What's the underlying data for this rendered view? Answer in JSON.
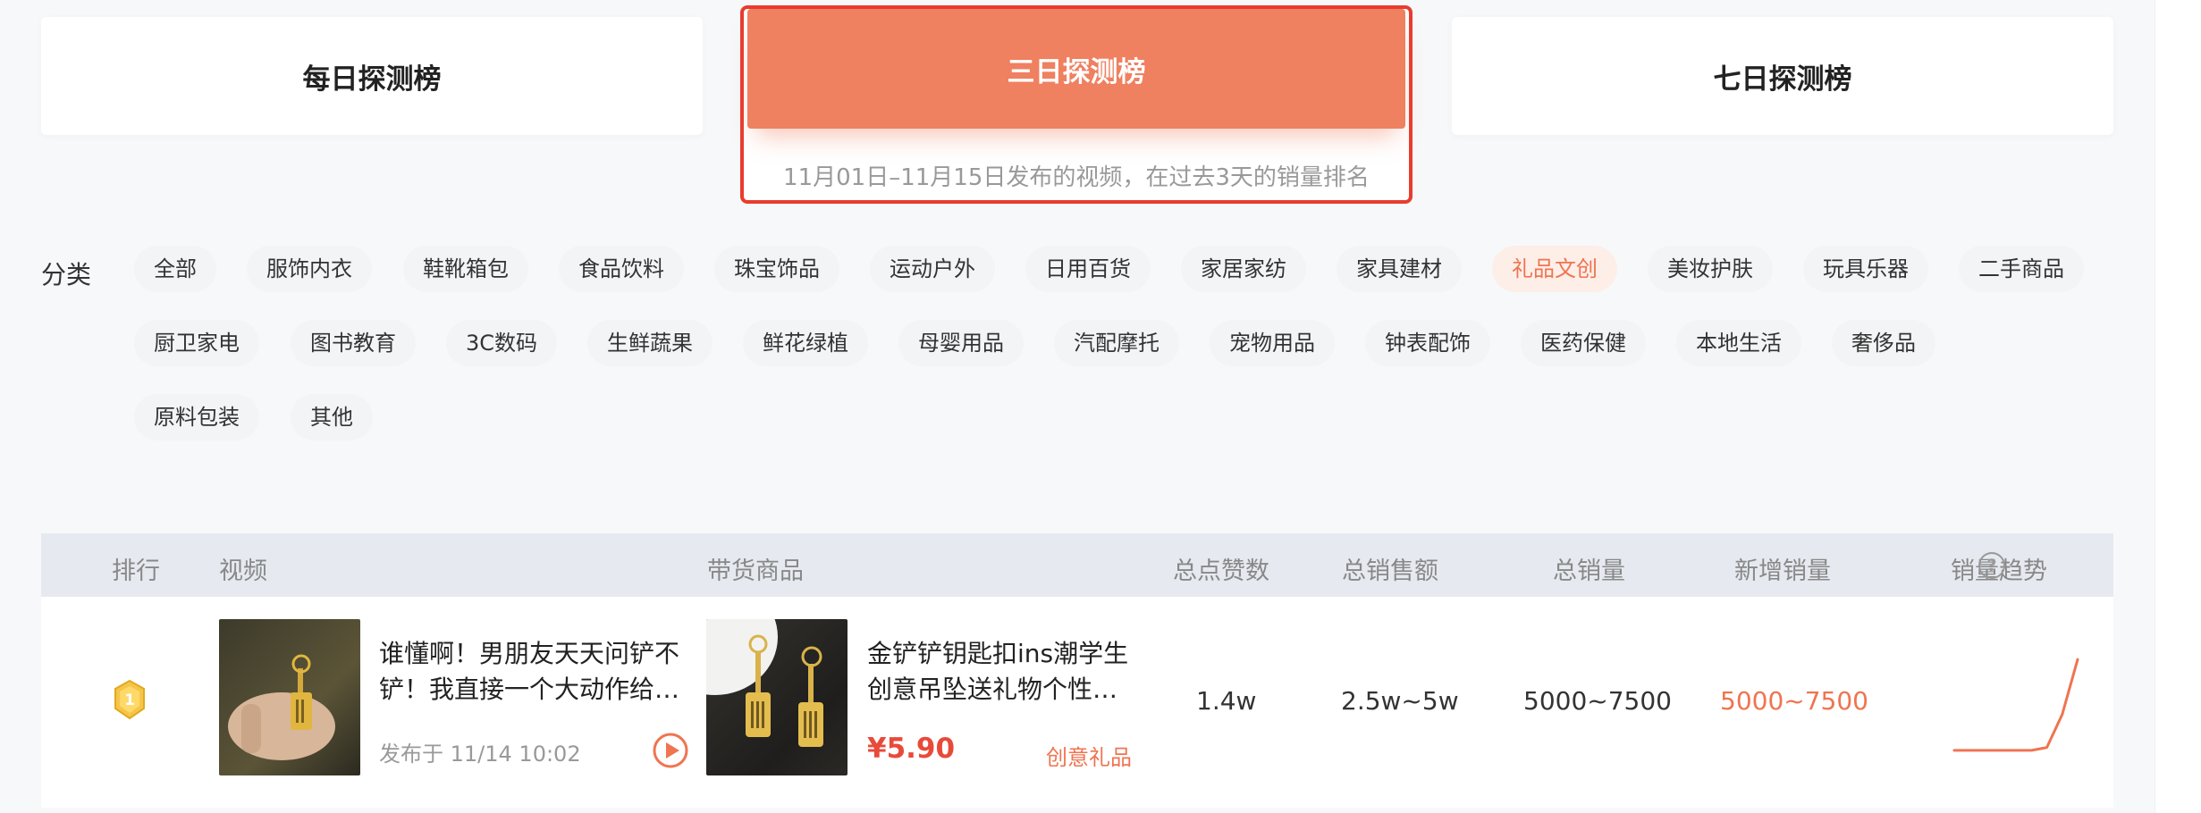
{
  "tabs": {
    "daily": "每日探测榜",
    "three_day": "三日探测榜",
    "three_day_subtitle": "11月01日–11月15日发布的视频，在过去3天的销量排名",
    "weekly": "七日探测榜"
  },
  "categories": {
    "label": "分类",
    "active": "礼品文创",
    "items": [
      "全部",
      "服饰内衣",
      "鞋靴箱包",
      "食品饮料",
      "珠宝饰品",
      "运动户外",
      "日用百货",
      "家居家纺",
      "家具建材",
      "礼品文创",
      "美妆护肤",
      "玩具乐器",
      "二手商品",
      "厨卫家电",
      "图书教育",
      "3C数码",
      "生鲜蔬果",
      "鲜花绿植",
      "母婴用品",
      "汽配摩托",
      "宠物用品",
      "钟表配饰",
      "医药保健",
      "本地生活",
      "奢侈品",
      "原料包装",
      "其他"
    ]
  },
  "table": {
    "headers": {
      "rank": "排行",
      "video": "视频",
      "product": "带货商品",
      "likes": "总点赞数",
      "gmv": "总销售额",
      "sales": "总销量",
      "new_sales": "新增销量",
      "trend": "销量趋势"
    },
    "help_icon": "question-circle-icon",
    "rows": [
      {
        "rank": "1",
        "video_title": "谁懂啊！男朋友天天问铲不铲！我直接一个大动作给…",
        "video_time": "发布于 11/14 10:02",
        "product_title": "金铲铲钥匙扣ins潮学生创意吊坠送礼物个性…",
        "price": "¥5.90",
        "product_tag": "创意礼品",
        "likes": "1.4w",
        "gmv": "2.5w~5w",
        "sales": "5000~7500",
        "new_sales": "5000~7500",
        "trend": [
          0.02,
          0.02,
          0.02,
          0.02,
          0.02,
          0.02,
          0.05,
          0.4,
          0.98
        ]
      }
    ]
  },
  "colors": {
    "accent": "#ef7450",
    "active_tab": "#ef8060",
    "highlight_border": "#e83c2e",
    "price": "#e84a3a",
    "header_bg": "#e6eaf0"
  }
}
